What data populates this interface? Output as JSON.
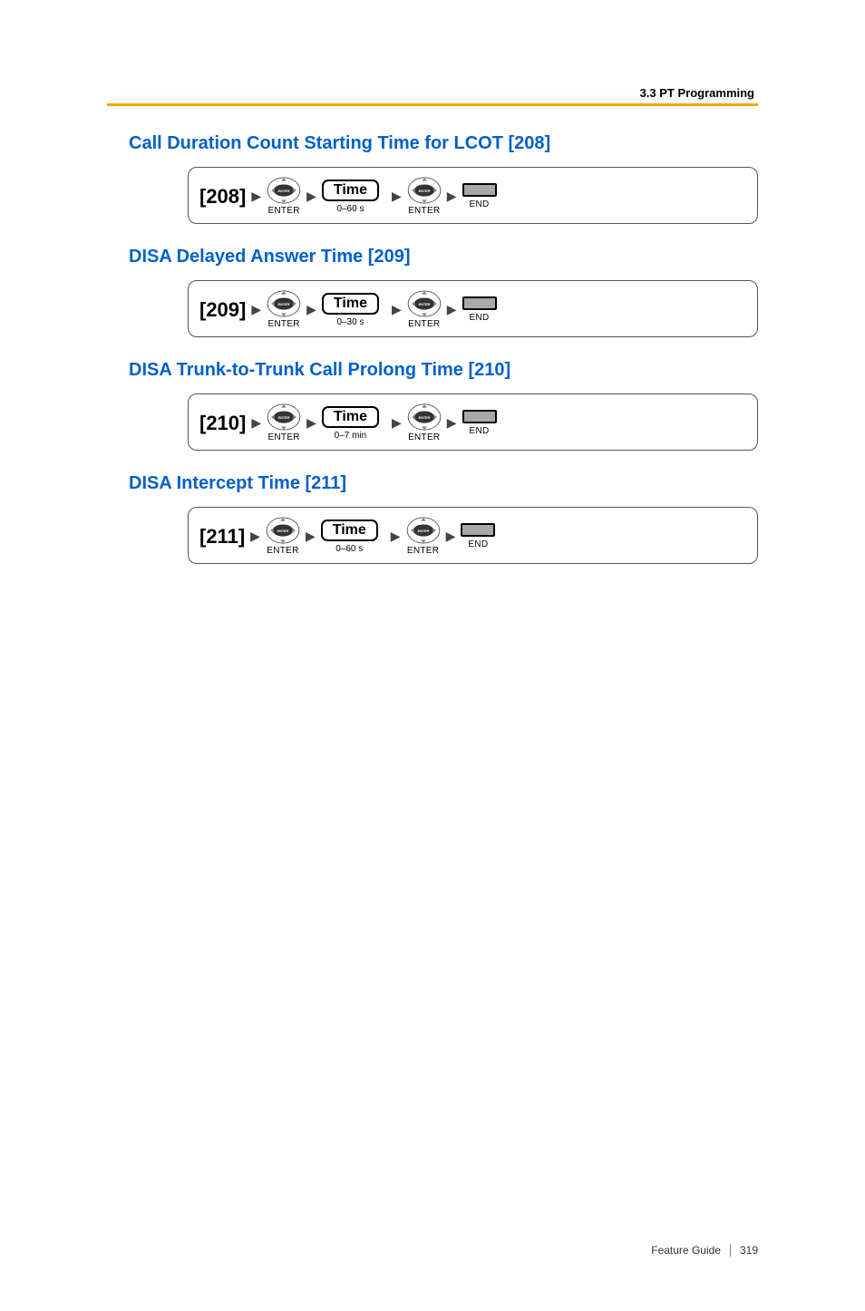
{
  "header": {
    "section_label": "3.3 PT Programming"
  },
  "sections": [
    {
      "title": "Call Duration Count Starting Time for LCOT [208]",
      "code": "[208]",
      "enter1_label": "ENTER",
      "time_label": "Time",
      "time_range": "0–60 s",
      "enter2_label": "ENTER",
      "end_label": "END"
    },
    {
      "title": "DISA Delayed Answer Time [209]",
      "code": "[209]",
      "enter1_label": "ENTER",
      "time_label": "Time",
      "time_range": "0–30 s",
      "enter2_label": "ENTER",
      "end_label": "END"
    },
    {
      "title": "DISA Trunk-to-Trunk Call Prolong Time [210]",
      "code": "[210]",
      "enter1_label": "ENTER",
      "time_label": "Time",
      "time_range": "0–7 min",
      "enter2_label": "ENTER",
      "end_label": "END"
    },
    {
      "title": "DISA Intercept Time [211]",
      "code": "[211]",
      "enter1_label": "ENTER",
      "time_label": "Time",
      "time_range": "0–60 s",
      "enter2_label": "ENTER",
      "end_label": "END"
    }
  ],
  "footer": {
    "guide_label": "Feature Guide",
    "page_number": "319"
  }
}
